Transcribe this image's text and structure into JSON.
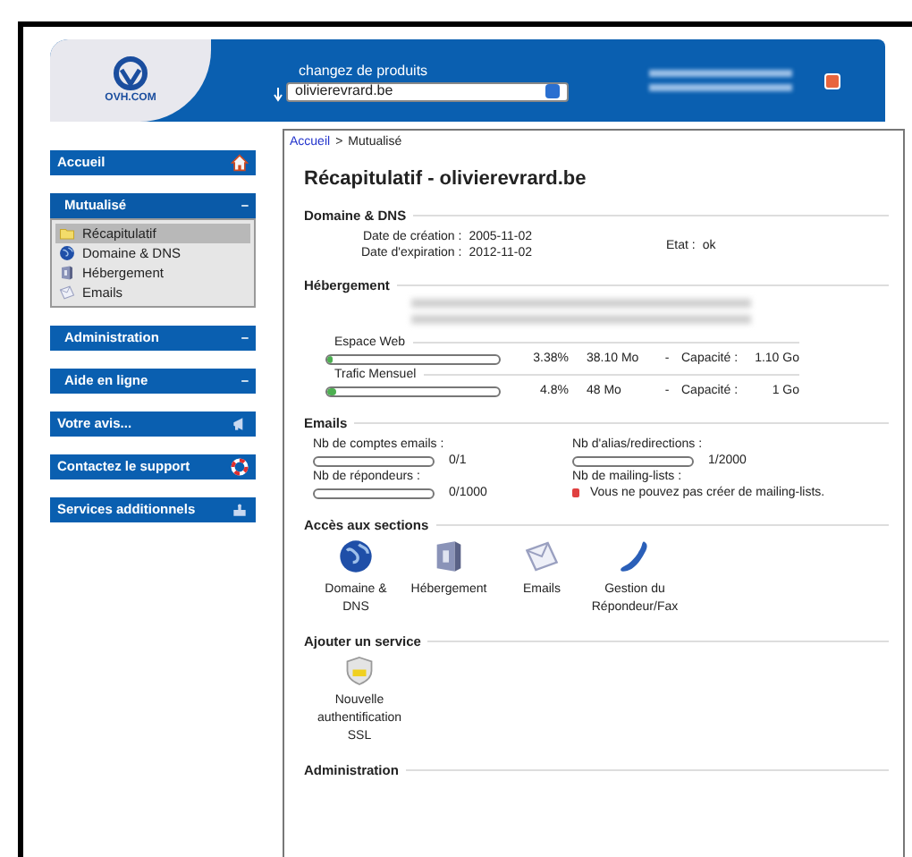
{
  "header": {
    "logo_text": "OVH.COM",
    "product_label": "changez de produits",
    "domain_select": "olivierevrard.be"
  },
  "sidebar": [
    {
      "label": "Accueil",
      "kind": "link"
    },
    {
      "label": "Mutualisé",
      "kind": "section",
      "toggle": "–",
      "expanded": true,
      "items": [
        {
          "label": "Récapitulatif",
          "selected": true
        },
        {
          "label": "Domaine & DNS",
          "selected": false
        },
        {
          "label": "Hébergement",
          "selected": false
        },
        {
          "label": "Emails",
          "selected": false
        }
      ]
    },
    {
      "label": "Administration",
      "kind": "section",
      "toggle": "–"
    },
    {
      "label": "Aide en ligne",
      "kind": "section",
      "toggle": "–"
    },
    {
      "label": "Votre avis...",
      "kind": "link"
    },
    {
      "label": "Contactez le support",
      "kind": "link"
    },
    {
      "label": "Services additionnels",
      "kind": "link"
    }
  ],
  "breadcrumb": {
    "link": "Accueil",
    "separator": ">",
    "current": "Mutualisé"
  },
  "title": "Récapitulatif - olivierevrard.be",
  "domain_section": {
    "heading": "Domaine & DNS",
    "rows": [
      {
        "label": "Date de création :",
        "value": "2005-11-02"
      },
      {
        "label": "Date d'expiration :",
        "value": "2012-11-02"
      }
    ],
    "status_label": "Etat :",
    "status_value": "ok"
  },
  "hosting_section": {
    "heading": "Hébergement",
    "meters": [
      {
        "name": "Espace Web",
        "level": 0.0338,
        "percent": "3.38%",
        "used": "38.10 Mo",
        "dash": "-",
        "capacity_label": "Capacité :",
        "capacity": "1.10 Go"
      },
      {
        "name": "Trafic Mensuel",
        "level": 0.048,
        "percent": "4.8%",
        "used": "48 Mo",
        "dash": "-",
        "capacity_label": "Capacité :",
        "capacity": "1 Go"
      }
    ]
  },
  "emails_section": {
    "heading": "Emails",
    "left": [
      {
        "label": "Nb de comptes emails :",
        "level": 0,
        "reading": "0/1"
      },
      {
        "label": "Nb de répondeurs :",
        "level": 0,
        "reading": "0/1000"
      }
    ],
    "right": [
      {
        "label": "Nb d'alias/redirections :",
        "level": 0.0005,
        "reading": "1/2000"
      }
    ],
    "mailing_label": "Nb de mailing-lists :",
    "mailing_warning": "Vous ne pouvez pas créer de mailing-lists."
  },
  "access_section": {
    "heading": "Accès aux sections",
    "items": [
      {
        "label": "Domaine & DNS"
      },
      {
        "label": "Hébergement"
      },
      {
        "label": "Emails"
      },
      {
        "label": "Gestion du Répondeur/Fax"
      }
    ]
  },
  "add_section": {
    "heading": "Ajouter un service",
    "items": [
      {
        "label": "Nouvelle authentification SSL"
      }
    ]
  },
  "admin_section": {
    "heading": "Administration"
  }
}
